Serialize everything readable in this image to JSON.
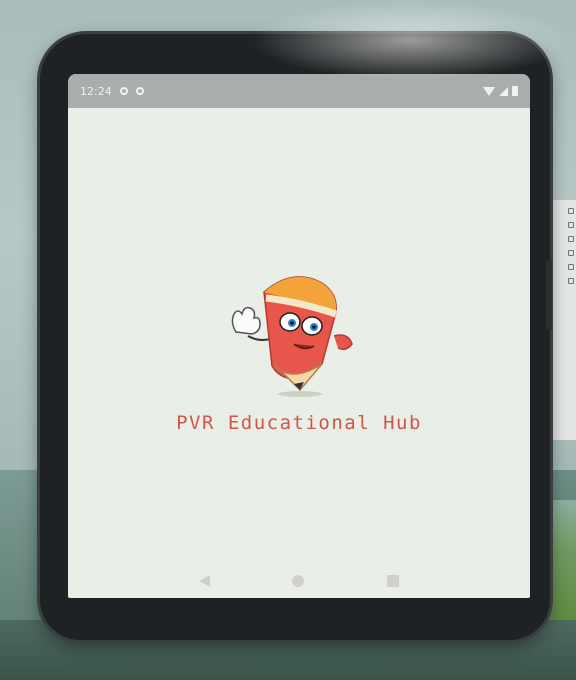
{
  "status_bar": {
    "time": "12:24",
    "icons": [
      "settings-dot-icon",
      "notification-dot-icon",
      "wifi-icon",
      "signal-icon",
      "battery-icon"
    ]
  },
  "splash": {
    "app_name": "PVR Educational Hub",
    "mascot": "pencil-mascot-icon",
    "colors": {
      "app_name": "#d0554a",
      "pencil_body": "#e8554a",
      "pencil_top": "#f2a43a",
      "background": "#e9efe6"
    }
  },
  "nav_bar": {
    "buttons": [
      "back-icon",
      "home-icon",
      "recents-icon"
    ]
  }
}
